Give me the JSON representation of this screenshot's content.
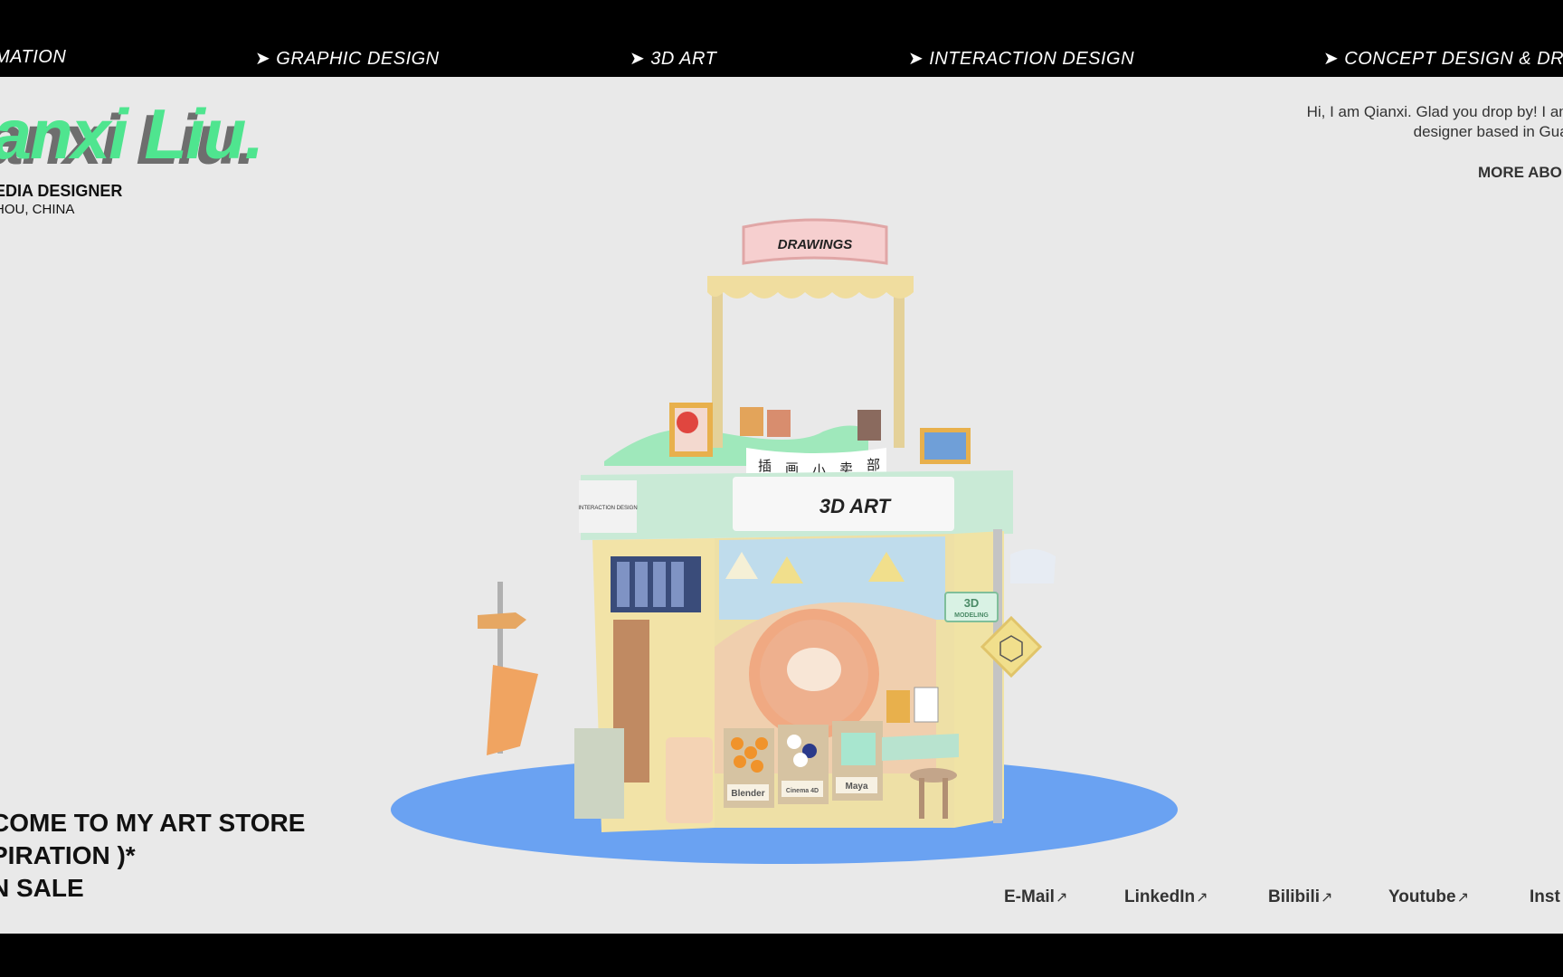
{
  "ticker": {
    "items": [
      {
        "text": "MATION",
        "arrow": false
      },
      {
        "text": "GRAPHIC DESIGN",
        "arrow": true
      },
      {
        "text": "3D ART",
        "arrow": true
      },
      {
        "text": "INTERACTION DESIGN",
        "arrow": true
      },
      {
        "text": "CONCEPT DESIGN & DRA",
        "arrow": true
      }
    ],
    "arrow_glyph": "➤"
  },
  "header": {
    "name": "ianxi Liu.",
    "role": "EDIA DESIGNER",
    "location": "HOU, CHINA",
    "intro_line1": "Hi, I am Qianxi. Glad you drop by! I am a Mu",
    "intro_line2": "designer based in Guangzho",
    "more_about": "MORE ABO"
  },
  "store": {
    "drawings_sign": "DRAWINGS",
    "art_sign": "3D ART",
    "side_sign": "INTERACTION DESIGN",
    "modeling_sign_top": "3D",
    "modeling_sign_bottom": "MODELING",
    "banner_chars": [
      "插",
      "画",
      "小",
      "卖",
      "部"
    ],
    "crate_labels": [
      "Blender",
      "Cinema 4D",
      "Maya"
    ]
  },
  "welcome": {
    "line1": "COME TO MY ART STORE",
    "line2": "PIRATION )*",
    "line3": "N SALE"
  },
  "social": {
    "arrow": "↗",
    "links": [
      "E-Mail",
      "LinkedIn",
      "Bilibili",
      "Youtube",
      "Inst"
    ]
  },
  "colors": {
    "accent_green": "#4fe58f",
    "background": "#e9e9e9",
    "base_blue": "#6aa2f2"
  }
}
